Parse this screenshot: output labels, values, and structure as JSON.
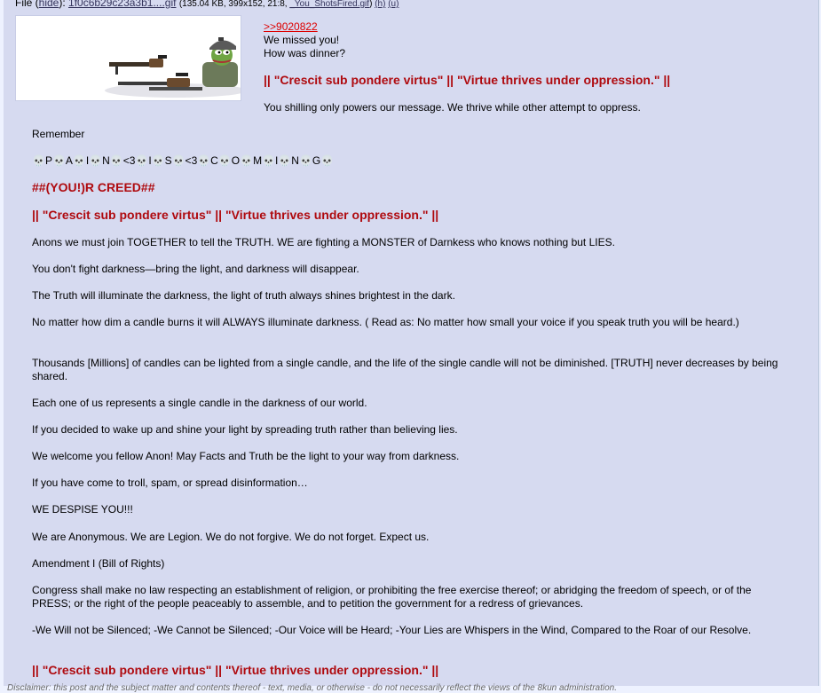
{
  "file": {
    "prefix": "File (",
    "hide": "hide",
    "after_hide": "): ",
    "name": "1f0c6b29c23a3b1....gif",
    "meta": "(135.04 KB, 399x152, 21:8, ",
    "orig_name": "_You_ShotsFired.gif",
    "meta_end": ")",
    "h": "(h)",
    "u": "(u)"
  },
  "intro": {
    "quote_link": ">>9020822",
    "line1": "We missed you!",
    "line2": "How was dinner?",
    "heading": "|| \"Crescit sub pondere virtus\" || \"Virtue thrives under oppression.\" ||",
    "line3": "You shilling only powers our message. We thrive while other attempt to oppress."
  },
  "remember": "Remember",
  "painting": "💀P💀A💀I💀N💀<3💀I💀S💀<3💀C💀O💀M💀I💀N💀G💀",
  "creed": "##(YOU!)R CREED##",
  "heading2": "|| \"Crescit sub pondere virtus\" || \"Virtue thrives under oppression.\" ||",
  "paragraphs": [
    "Anons we must join TOGETHER to tell the TRUTH. WE are fighting a MONSTER of Darnkess who knows nothing but LIES.",
    "You don't fight darkness—bring the light, and darkness will disappear.",
    "The Truth will illuminate the darkness, the light of truth always shines brightest in the dark.",
    "No matter how dim a candle burns it will ALWAYS illuminate darkness. ( Read as: No matter how small your voice if you speak truth you will be heard.)",
    "Thousands [Millions] of candles can be lighted from a single candle, and the life of the single candle will not be diminished. [TRUTH] never decreases by being shared.",
    "Each one of us represents a single candle in the darkness of our world.",
    "If you decided to wake up and shine your light by spreading truth rather than believing lies.",
    "We welcome you fellow Anon! May Facts and Truth be the light to your way from darkness.",
    "If you have come to troll, spam, or spread disinformation…",
    "WE DESPISE YOU!!!",
    "We are Anonymous. We are Legion. We do not forgive. We do not forget. Expect us.",
    "Amendment I (Bill of Rights)",
    "Congress shall make no law respecting an establishment of religion, or prohibiting the free exercise thereof; or abridging the freedom of speech, or of the PRESS; or the right of the people peaceably to assemble, and to petition the government for a redress of grievances.",
    "-We Will not be Silenced;  -We Cannot be Silenced;  -Our Voice will be Heard;   -Your Lies are Whispers in the Wind, Compared to the Roar of our Resolve."
  ],
  "heading3": "|| \"Crescit sub pondere virtus\" || \"Virtue thrives under oppression.\" ||",
  "disclaimer": "Disclaimer: this post and the subject matter and contents thereof - text, media, or otherwise - do not necessarily reflect the views of the 8kun administration.",
  "colors": {
    "post_bg": "#d6daf0",
    "heading": "#af0a0f",
    "link": "#34345c",
    "quote": "#dd0000"
  }
}
